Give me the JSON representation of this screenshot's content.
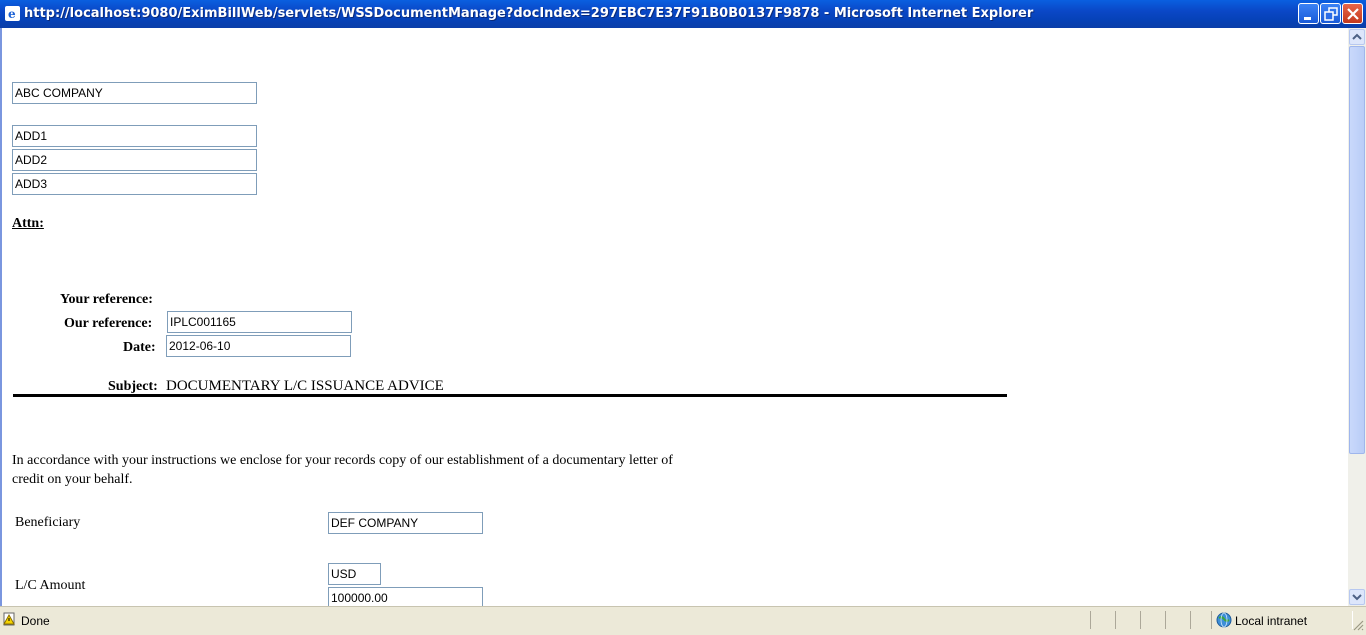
{
  "window": {
    "title": "http://localhost:9080/EximBillWeb/servlets/WSSDocumentManage?docIndex=297EBC7E37F91B0B0137F9878 - Microsoft Internet Explorer"
  },
  "document": {
    "company_name": "ABC COMPANY",
    "address_lines": [
      "ADD1",
      "ADD2",
      "ADD3"
    ],
    "attn_label": "Attn:",
    "your_reference_label": "Your reference:",
    "our_reference_label": "Our reference:",
    "our_reference_value": "IPLC001165",
    "date_label": "Date:",
    "date_value": "2012-06-10",
    "subject_label": "Subject:",
    "subject_value": "DOCUMENTARY L/C ISSUANCE ADVICE",
    "body_line1": "In accordance with your instructions we enclose for your records copy of our establishment of a documentary letter of",
    "body_line2": "credit on your behalf.",
    "beneficiary_label": "Beneficiary",
    "beneficiary_value": "DEF COMPANY",
    "lc_amount_label": "L/C Amount",
    "currency_value": "USD",
    "amount_value": "100000.00"
  },
  "statusbar": {
    "status_text": "Done",
    "zone_text": "Local intranet"
  }
}
